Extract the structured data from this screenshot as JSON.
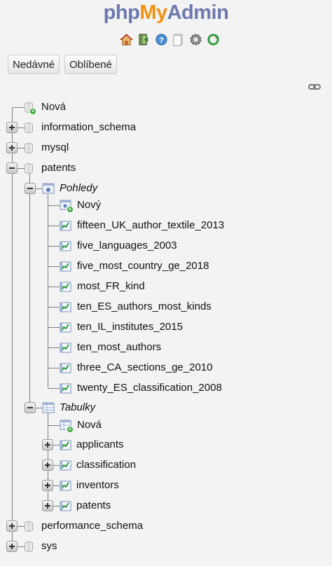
{
  "logo": {
    "php": "php",
    "my": "My",
    "admin": "Admin"
  },
  "icons": [
    "home-icon",
    "logout-icon",
    "help-icon",
    "documentation-icon",
    "settings-icon",
    "reload-icon"
  ],
  "buttons": {
    "recent": "Nedávné",
    "favorites": "Oblíbené"
  },
  "tree": {
    "new_db": "Nová",
    "databases": [
      "information_schema",
      "mysql",
      "patents",
      "performance_schema",
      "sys"
    ],
    "views_group": "Pohledy",
    "new_view": "Nový",
    "views": [
      "fifteen_UK_author_textile_2013",
      "five_languages_2003",
      "five_most_country_ge_2018",
      "most_FR_kind",
      "ten_ES_authors_most_kinds",
      "ten_IL_institutes_2015",
      "ten_most_authors",
      "three_CA_sections_ge_2010",
      "twenty_ES_classification_2008"
    ],
    "tables_group": "Tabulky",
    "new_table": "Nová",
    "tables": [
      "applicants",
      "classification",
      "inventors",
      "patents"
    ]
  },
  "colors": {
    "logo_blue": "#6c78af",
    "logo_orange": "#f29111",
    "badge_green": "#3aa83a",
    "background": "#f3f3f3"
  }
}
